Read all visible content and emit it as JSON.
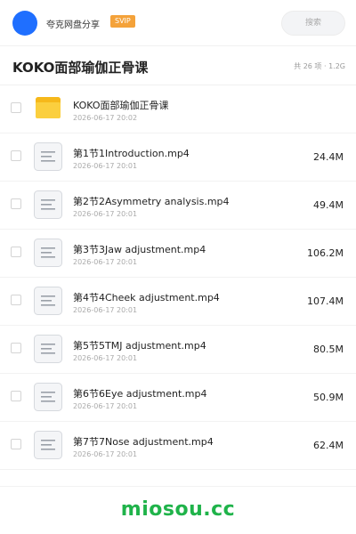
{
  "header": {
    "share_name": "夸克网盘分享",
    "svip_label": "SVIP",
    "search_placeholder": "搜索"
  },
  "title_bar": {
    "title": "KOKO面部瑜伽正骨课",
    "summary": "共 26 项 · 1.2G"
  },
  "colors": {
    "avatar": "#1f6fff",
    "svip_badge": "#f4a23a",
    "folder": "#f8c528",
    "watermark": "#1fb34a"
  },
  "files": [
    {
      "name": "KOKO面部瑜伽正骨课",
      "date": "2026-06-17 20:02",
      "size": "",
      "icon": "folder-icon"
    },
    {
      "name": "第1节1Introduction.mp4",
      "date": "2026-06-17 20:01",
      "size": "24.4M",
      "icon": "document-icon"
    },
    {
      "name": "第2节2Asymmetry analysis.mp4",
      "date": "2026-06-17 20:01",
      "size": "49.4M",
      "icon": "document-icon"
    },
    {
      "name": "第3节3Jaw adjustment.mp4",
      "date": "2026-06-17 20:01",
      "size": "106.2M",
      "icon": "document-icon"
    },
    {
      "name": "第4节4Cheek adjustment.mp4",
      "date": "2026-06-17 20:01",
      "size": "107.4M",
      "icon": "document-icon"
    },
    {
      "name": "第5节5TMJ adjustment.mp4",
      "date": "2026-06-17 20:01",
      "size": "80.5M",
      "icon": "document-icon"
    },
    {
      "name": "第6节6Eye adjustment.mp4",
      "date": "2026-06-17 20:01",
      "size": "50.9M",
      "icon": "document-icon"
    },
    {
      "name": "第7节7Nose adjustment.mp4",
      "date": "2026-06-17 20:01",
      "size": "62.4M",
      "icon": "document-icon"
    }
  ],
  "watermark": "miosou.cc"
}
